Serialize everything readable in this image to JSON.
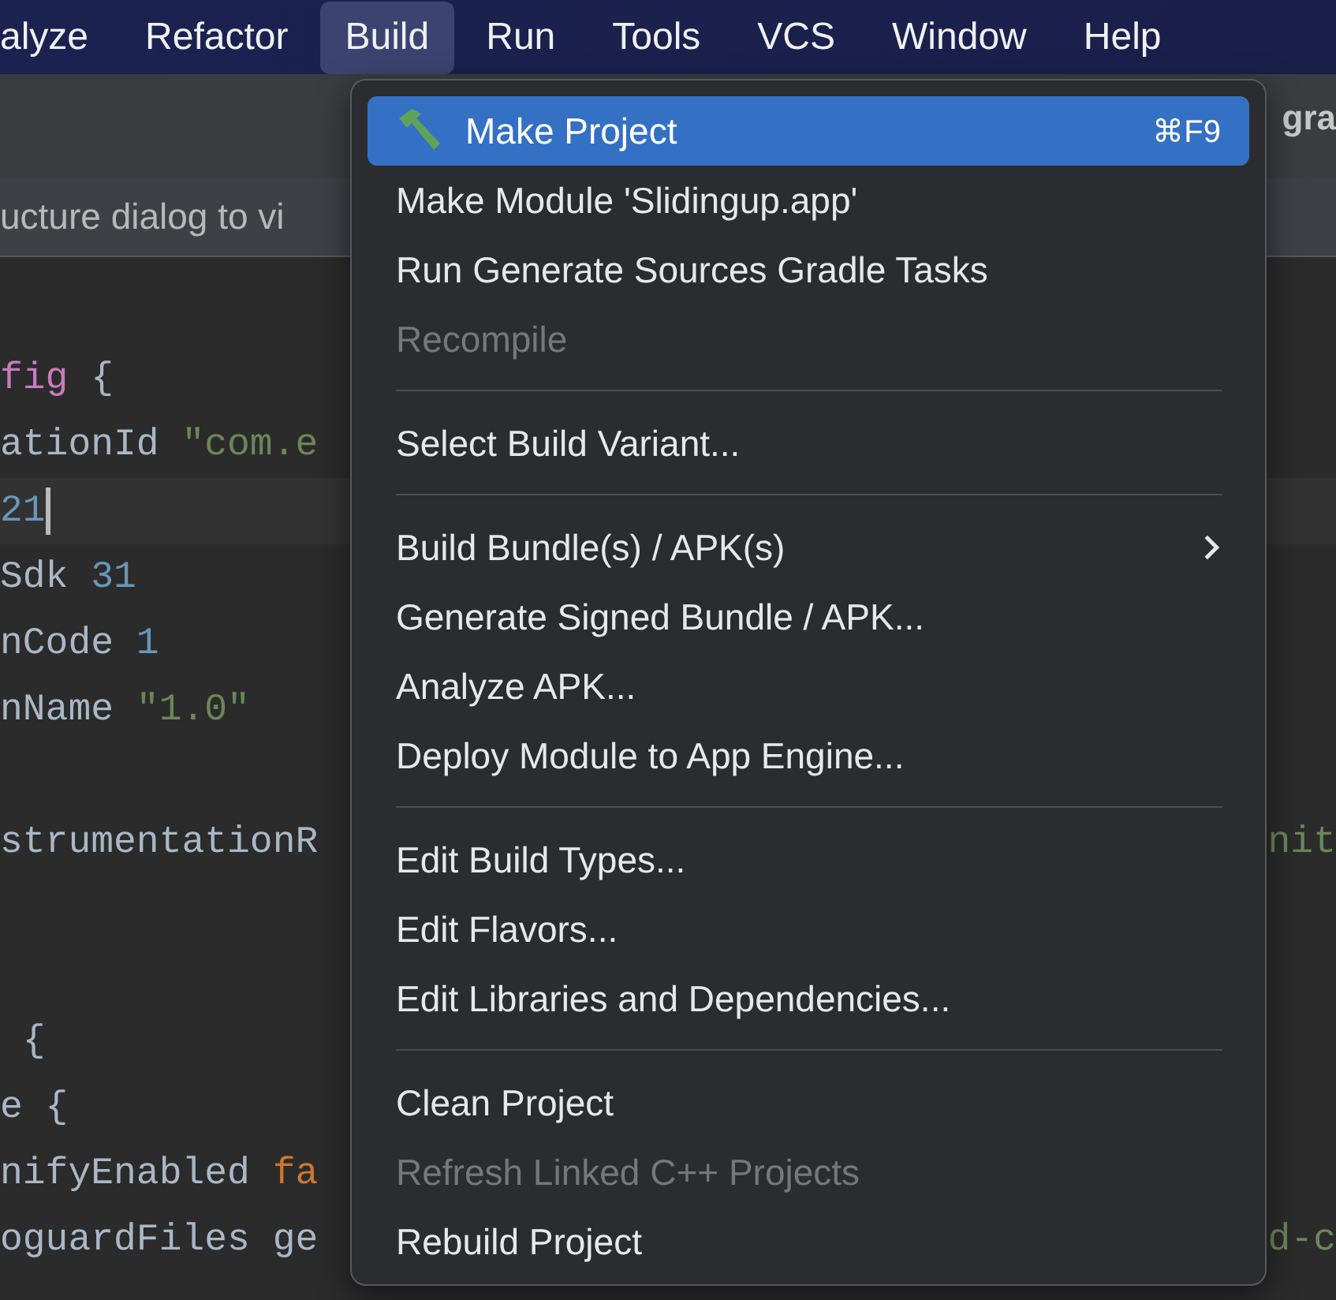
{
  "menubar": [
    {
      "label": "alyze",
      "selected": false
    },
    {
      "label": "Refactor",
      "selected": false
    },
    {
      "label": "Build",
      "selected": true
    },
    {
      "label": "Run",
      "selected": false
    },
    {
      "label": "Tools",
      "selected": false
    },
    {
      "label": "VCS",
      "selected": false
    },
    {
      "label": "Window",
      "selected": false
    },
    {
      "label": "Help",
      "selected": false
    }
  ],
  "tab_bar": {
    "tab_fragment": "gra"
  },
  "banner": {
    "text": "ucture dialog to vi"
  },
  "editor": {
    "lines": [
      {
        "kind": "blank"
      },
      {
        "kind": "code",
        "current": false,
        "segments": [
          {
            "kind": "keyword",
            "text": "fig"
          },
          {
            "kind": "plain",
            "text": " {"
          }
        ]
      },
      {
        "kind": "code",
        "current": false,
        "segments": [
          {
            "kind": "plain",
            "text": "ationId "
          },
          {
            "kind": "string",
            "text": "\"com.e"
          }
        ]
      },
      {
        "kind": "code",
        "current": true,
        "segments": [
          {
            "kind": "number",
            "text": "21"
          }
        ]
      },
      {
        "kind": "code",
        "current": false,
        "segments": [
          {
            "kind": "plain",
            "text": "Sdk "
          },
          {
            "kind": "number",
            "text": "31"
          }
        ]
      },
      {
        "kind": "code",
        "current": false,
        "segments": [
          {
            "kind": "plain",
            "text": "nCode "
          },
          {
            "kind": "number",
            "text": "1"
          }
        ]
      },
      {
        "kind": "code",
        "current": false,
        "segments": [
          {
            "kind": "plain",
            "text": "nName "
          },
          {
            "kind": "string",
            "text": "\"1.0\""
          }
        ]
      },
      {
        "kind": "blank"
      },
      {
        "kind": "code",
        "current": false,
        "segments": [
          {
            "kind": "plain",
            "text": "strumentationR"
          }
        ],
        "right": {
          "kind": "string",
          "text": "nit"
        }
      },
      {
        "kind": "blank"
      },
      {
        "kind": "blank"
      },
      {
        "kind": "code",
        "current": false,
        "segments": [
          {
            "kind": "plain",
            "text": " {"
          }
        ]
      },
      {
        "kind": "code",
        "current": false,
        "segments": [
          {
            "kind": "plain",
            "text": "e {"
          }
        ]
      },
      {
        "kind": "code",
        "current": false,
        "segments": [
          {
            "kind": "plain",
            "text": "nifyEnabled "
          },
          {
            "kind": "keyword2",
            "text": "fa"
          }
        ]
      },
      {
        "kind": "code",
        "current": false,
        "segments": [
          {
            "kind": "plain",
            "text": "oguardFiles ge"
          }
        ],
        "right": {
          "kind": "string",
          "text": "d-c"
        }
      }
    ]
  },
  "menu": {
    "items": [
      {
        "kind": "icon_item",
        "label": "Make Project",
        "selected": true,
        "disabled": false,
        "shortcut": "⌘F9"
      },
      {
        "kind": "item",
        "label": "Make Module 'Slidingup.app'",
        "selected": false,
        "disabled": false
      },
      {
        "kind": "item",
        "label": "Run Generate Sources Gradle Tasks",
        "selected": false,
        "disabled": false
      },
      {
        "kind": "item",
        "label": "Recompile",
        "selected": false,
        "disabled": true
      },
      {
        "kind": "separator"
      },
      {
        "kind": "item",
        "label": "Select Build Variant...",
        "selected": false,
        "disabled": false
      },
      {
        "kind": "separator"
      },
      {
        "kind": "item",
        "label": "Build Bundle(s) / APK(s)",
        "selected": false,
        "disabled": false,
        "submenu": true
      },
      {
        "kind": "item",
        "label": "Generate Signed Bundle / APK...",
        "selected": false,
        "disabled": false
      },
      {
        "kind": "item",
        "label": "Analyze APK...",
        "selected": false,
        "disabled": false
      },
      {
        "kind": "item",
        "label": "Deploy Module to App Engine...",
        "selected": false,
        "disabled": false
      },
      {
        "kind": "separator"
      },
      {
        "kind": "item",
        "label": "Edit Build Types...",
        "selected": false,
        "disabled": false
      },
      {
        "kind": "item",
        "label": "Edit Flavors...",
        "selected": false,
        "disabled": false
      },
      {
        "kind": "item",
        "label": "Edit Libraries and Dependencies...",
        "selected": false,
        "disabled": false
      },
      {
        "kind": "separator"
      },
      {
        "kind": "item",
        "label": "Clean Project",
        "selected": false,
        "disabled": false
      },
      {
        "kind": "item",
        "label": "Refresh Linked C++ Projects",
        "selected": false,
        "disabled": true
      },
      {
        "kind": "item",
        "label": "Rebuild Project",
        "selected": false,
        "disabled": false
      }
    ]
  }
}
